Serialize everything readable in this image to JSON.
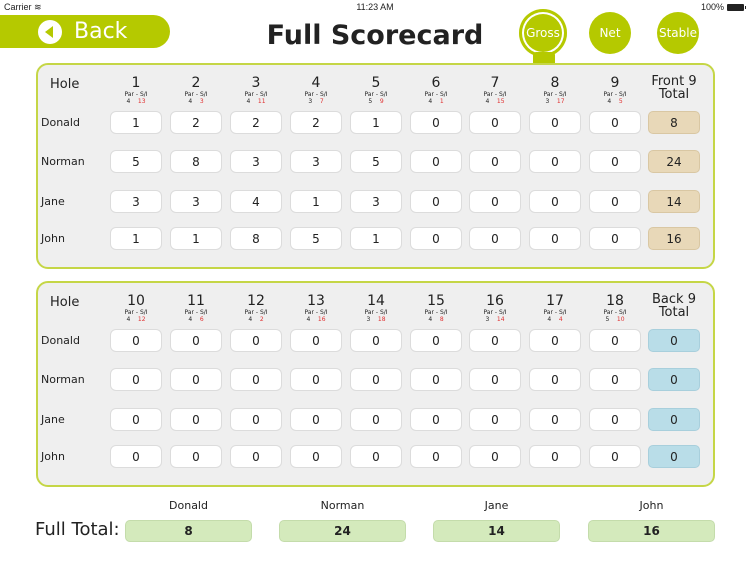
{
  "status_bar": {
    "carrier": "Carrier",
    "time": "11:23 AM",
    "battery": "100%"
  },
  "header": {
    "back_label": "Back",
    "title": "Full Scorecard"
  },
  "modes": [
    {
      "label": "Gross",
      "active": true
    },
    {
      "label": "Net",
      "active": false
    },
    {
      "label": "Stable",
      "active": false
    }
  ],
  "labels": {
    "hole": "Hole",
    "par": "Par",
    "si": "S/I",
    "dash": "-",
    "front_total_l1": "Front 9",
    "front_total_l2": "Total",
    "back_total_l1": "Back 9",
    "back_total_l2": "Total",
    "full_total": "Full Total:"
  },
  "front_nine": {
    "holes": [
      {
        "num": "1",
        "par": "4",
        "si": "13"
      },
      {
        "num": "2",
        "par": "4",
        "si": "3"
      },
      {
        "num": "3",
        "par": "4",
        "si": "11"
      },
      {
        "num": "4",
        "par": "3",
        "si": "7"
      },
      {
        "num": "5",
        "par": "5",
        "si": "9"
      },
      {
        "num": "6",
        "par": "4",
        "si": "1"
      },
      {
        "num": "7",
        "par": "4",
        "si": "15"
      },
      {
        "num": "8",
        "par": "3",
        "si": "17"
      },
      {
        "num": "9",
        "par": "4",
        "si": "5"
      }
    ],
    "players": [
      {
        "name": "Donald",
        "scores": [
          "1",
          "2",
          "2",
          "2",
          "1",
          "0",
          "0",
          "0",
          "0"
        ],
        "total": "8"
      },
      {
        "name": "Norman",
        "scores": [
          "5",
          "8",
          "3",
          "3",
          "5",
          "0",
          "0",
          "0",
          "0"
        ],
        "total": "24"
      },
      {
        "name": "Jane",
        "scores": [
          "3",
          "3",
          "4",
          "1",
          "3",
          "0",
          "0",
          "0",
          "0"
        ],
        "total": "14"
      },
      {
        "name": "John",
        "scores": [
          "1",
          "1",
          "8",
          "5",
          "1",
          "0",
          "0",
          "0",
          "0"
        ],
        "total": "16"
      }
    ]
  },
  "back_nine": {
    "holes": [
      {
        "num": "10",
        "par": "4",
        "si": "12"
      },
      {
        "num": "11",
        "par": "4",
        "si": "6"
      },
      {
        "num": "12",
        "par": "4",
        "si": "2"
      },
      {
        "num": "13",
        "par": "4",
        "si": "16"
      },
      {
        "num": "14",
        "par": "3",
        "si": "18"
      },
      {
        "num": "15",
        "par": "4",
        "si": "8"
      },
      {
        "num": "16",
        "par": "3",
        "si": "14"
      },
      {
        "num": "17",
        "par": "4",
        "si": "4"
      },
      {
        "num": "18",
        "par": "5",
        "si": "10"
      }
    ],
    "players": [
      {
        "name": "Donald",
        "scores": [
          "0",
          "0",
          "0",
          "0",
          "0",
          "0",
          "0",
          "0",
          "0"
        ],
        "total": "0"
      },
      {
        "name": "Norman",
        "scores": [
          "0",
          "0",
          "0",
          "0",
          "0",
          "0",
          "0",
          "0",
          "0"
        ],
        "total": "0"
      },
      {
        "name": "Jane",
        "scores": [
          "0",
          "0",
          "0",
          "0",
          "0",
          "0",
          "0",
          "0",
          "0"
        ],
        "total": "0"
      },
      {
        "name": "John",
        "scores": [
          "0",
          "0",
          "0",
          "0",
          "0",
          "0",
          "0",
          "0",
          "0"
        ],
        "total": "0"
      }
    ]
  },
  "full_totals": [
    {
      "name": "Donald",
      "total": "8"
    },
    {
      "name": "Norman",
      "total": "24"
    },
    {
      "name": "Jane",
      "total": "14"
    },
    {
      "name": "John",
      "total": "16"
    }
  ],
  "colors": {
    "accent": "#b5c900",
    "panel_border": "#c5d646",
    "front_total": "#e8d8b8",
    "back_total": "#b9dde8",
    "full_total": "#d4eabc",
    "si_red": "#e03030"
  }
}
